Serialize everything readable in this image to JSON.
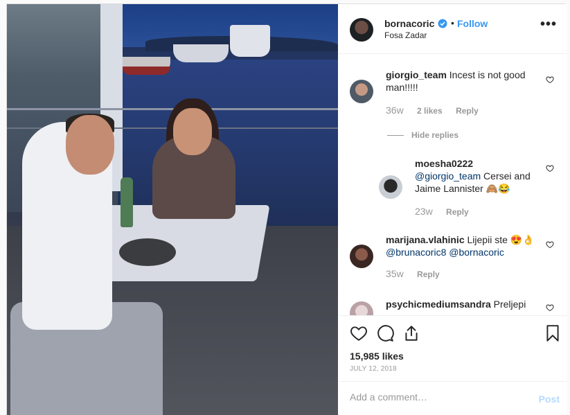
{
  "post": {
    "author": "bornacoric",
    "follow_label": "Follow",
    "separator": "•",
    "location": "Fosa Zadar",
    "more_label": "•••",
    "accent_color": "#3897f0"
  },
  "comments": [
    {
      "username": "giorgio_team",
      "text": "Incest is not good man!!!!!",
      "time": "36w",
      "likes": "2 likes",
      "reply_label": "Reply"
    },
    {
      "username": "moesha0222",
      "mention": "@giorgio_team",
      "text": "Cersei and Jaime Lannister 🙈😂",
      "time": "23w",
      "reply_label": "Reply"
    },
    {
      "username": "marijana.vlahinic",
      "text": "Lijepii ste 😍👌",
      "mentions": "@brunacoric8 @bornacoric",
      "time": "35w",
      "reply_label": "Reply"
    },
    {
      "username": "psychicmediumsandra",
      "text": "Preljepi"
    }
  ],
  "hide_replies_label": "Hide replies",
  "stats": {
    "likes": "15,985 likes",
    "date": "JULY 12, 2018"
  },
  "add_comment": {
    "placeholder": "Add a comment…",
    "post_label": "Post"
  },
  "icons": [
    "verified-badge-icon",
    "heart-icon",
    "comment-icon",
    "share-icon",
    "bookmark-icon",
    "more-icon"
  ]
}
